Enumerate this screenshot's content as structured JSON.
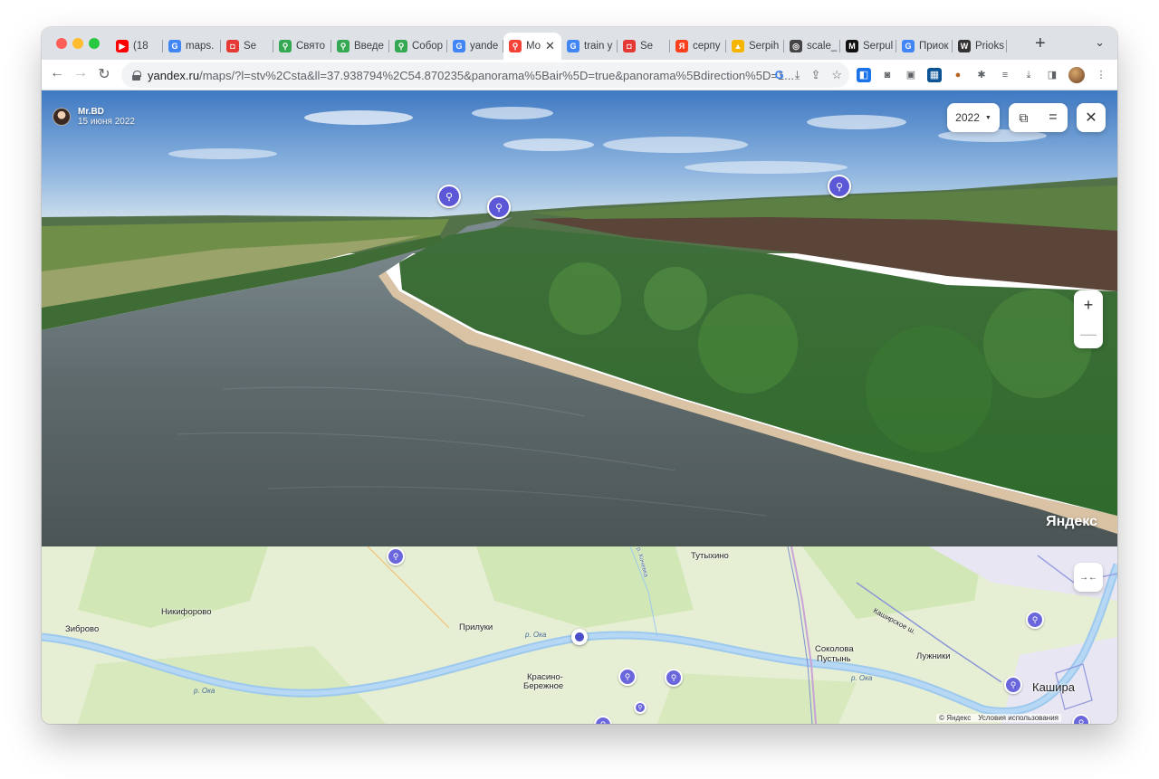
{
  "browser": {
    "tabs": [
      {
        "icon": "youtube-icon",
        "label": "(18",
        "color": "#ff0000",
        "glyph": "▶"
      },
      {
        "icon": "google-icon",
        "label": "maps.",
        "color": "#4285f4",
        "glyph": "G"
      },
      {
        "icon": "serpuhov-icon",
        "label": "Se",
        "color": "#e53935",
        "glyph": "◘"
      },
      {
        "icon": "maps-pin-icon",
        "label": "Свято",
        "color": "#34a853",
        "glyph": "⚲"
      },
      {
        "icon": "maps-pin-icon",
        "label": "Введе",
        "color": "#34a853",
        "glyph": "⚲"
      },
      {
        "icon": "maps-pin-icon",
        "label": "Собор",
        "color": "#34a853",
        "glyph": "⚲"
      },
      {
        "icon": "google-icon",
        "label": "yande",
        "color": "#4285f4",
        "glyph": "G"
      },
      {
        "icon": "yandex-maps-icon",
        "label": "Mo",
        "color": "#f44336",
        "glyph": "⚲"
      },
      {
        "icon": "google-icon",
        "label": "train y",
        "color": "#4285f4",
        "glyph": "G"
      },
      {
        "icon": "serpuhov-icon",
        "label": "Se",
        "color": "#e53935",
        "glyph": "◘"
      },
      {
        "icon": "yandex-icon",
        "label": "серпу",
        "color": "#fc3f1d",
        "glyph": "Я"
      },
      {
        "icon": "serpih-icon",
        "label": "Serpih",
        "color": "#f6b500",
        "glyph": "▲"
      },
      {
        "icon": "globe-icon",
        "label": "scale_",
        "color": "#444444",
        "glyph": "◎"
      },
      {
        "icon": "m-icon",
        "label": "Serpul",
        "color": "#111111",
        "glyph": "M"
      },
      {
        "icon": "google-icon",
        "label": "Приок",
        "color": "#4285f4",
        "glyph": "G"
      },
      {
        "icon": "wikipedia-icon",
        "label": "Prioks",
        "color": "#333333",
        "glyph": "W"
      }
    ],
    "active_tab_index": 7,
    "new_tab": "+",
    "tab_menu": "⌄",
    "url_host": "yandex.ru",
    "url_rest": "/maps/?l=stv%2Csta&ll=37.938794%2C54.870235&panorama%5Bair%5D=true&panorama%5Bdirection%5D=1..."
  },
  "panorama": {
    "author_name": "Mr.BD",
    "author_date": "15 июня 2022",
    "year": "2022",
    "zoom_in": "+",
    "zoom_out": "—",
    "close": "✕",
    "logo": "Яндекс"
  },
  "map": {
    "labels": {
      "zibrovo": "Зиброво",
      "nikiforovo": "Никифорово",
      "priluki": "Прилуки",
      "krasino": "Красино-",
      "uberezhnoe": "Бережное",
      "tutyhino": "Тутыхино",
      "sokolova": "Соколова",
      "pustyn": "Пустынь",
      "luzhniki": "Лужники",
      "kashira": "Кашира",
      "kashirskoe": "Каширское ш.",
      "kochevka": "р. Кочевка"
    },
    "river_labels": [
      "р. Ока",
      "р. Ока",
      "р. Ока"
    ],
    "footer_copyright": "© Яндекс",
    "footer_terms": "Условия использования"
  }
}
